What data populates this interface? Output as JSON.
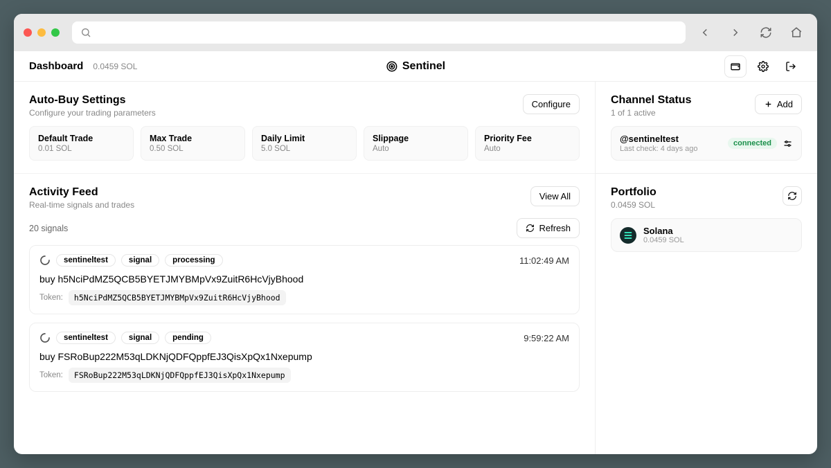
{
  "header": {
    "title": "Dashboard",
    "balance": "0.0459 SOL",
    "brand": "Sentinel"
  },
  "autobuy": {
    "title": "Auto-Buy Settings",
    "subtitle": "Configure your trading parameters",
    "configure": "Configure",
    "cards": [
      {
        "label": "Default Trade",
        "value": "0.01 SOL"
      },
      {
        "label": "Max Trade",
        "value": "0.50 SOL"
      },
      {
        "label": "Daily Limit",
        "value": "5.0 SOL"
      },
      {
        "label": "Slippage",
        "value": "Auto"
      },
      {
        "label": "Priority Fee",
        "value": "Auto"
      }
    ]
  },
  "activity": {
    "title": "Activity Feed",
    "subtitle": "Real-time signals and trades",
    "view_all": "View All",
    "count_label": "20 signals",
    "refresh": "Refresh",
    "token_label": "Token:",
    "items": [
      {
        "source": "sentineltest",
        "kind": "signal",
        "status": "processing",
        "time": "11:02:49 AM",
        "body": "buy h5NciPdMZ5QCB5BYETJMYBMpVx9ZuitR6HcVjyBhood",
        "token": "h5NciPdMZ5QCB5BYETJMYBMpVx9ZuitR6HcVjyBhood"
      },
      {
        "source": "sentineltest",
        "kind": "signal",
        "status": "pending",
        "time": "9:59:22 AM",
        "body": "buy FSRoBup222M53qLDKNjQDFQppfEJ3QisXpQx1Nxepump",
        "token": "FSRoBup222M53qLDKNjQDFQppfEJ3QisXpQx1Nxepump"
      }
    ]
  },
  "channels": {
    "title": "Channel Status",
    "subtitle": "1 of 1 active",
    "add": "Add",
    "items": [
      {
        "name": "@sentineltest",
        "subtitle": "Last check: 4 days ago",
        "status": "connected"
      }
    ]
  },
  "portfolio": {
    "title": "Portfolio",
    "subtitle": "0.0459 SOL",
    "items": [
      {
        "name": "Solana",
        "amount": "0.0459 SOL"
      }
    ]
  }
}
